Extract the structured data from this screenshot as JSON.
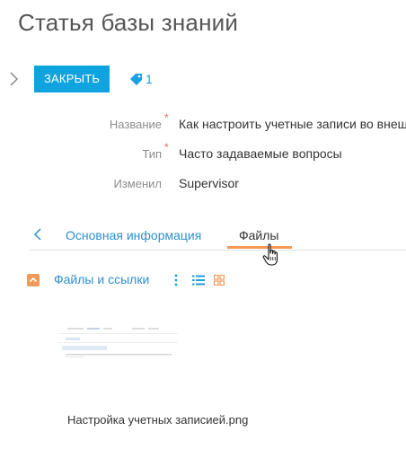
{
  "page": {
    "title": "Статья базы знаний"
  },
  "toolbar": {
    "close_label": "ЗАКРЫТЬ",
    "tag_count": "1"
  },
  "fields": [
    {
      "label": "Название",
      "required": true,
      "value": "Как настроить учетные записи во внешних ресурсах"
    },
    {
      "label": "Тип",
      "required": true,
      "value": "Часто задаваемые вопросы"
    },
    {
      "label": "Изменил",
      "required": false,
      "value": "Supervisor"
    }
  ],
  "tabs": [
    {
      "label": "Основная информация",
      "active": false
    },
    {
      "label": "Файлы",
      "active": true
    }
  ],
  "files_section": {
    "title": "Файлы и ссылки",
    "files": [
      {
        "name": "Настройка учетных записией.png"
      }
    ]
  },
  "colors": {
    "accent_blue": "#0fa3e0",
    "link_blue": "#2c8fd1",
    "orange": "#f39a58",
    "required": "#f06a5d"
  },
  "icons": [
    "chevron-right-icon",
    "tag-icon",
    "chevron-left-icon",
    "collapse-icon",
    "more-vertical-icon",
    "list-view-icon",
    "tile-view-icon",
    "hand-cursor-icon"
  ]
}
